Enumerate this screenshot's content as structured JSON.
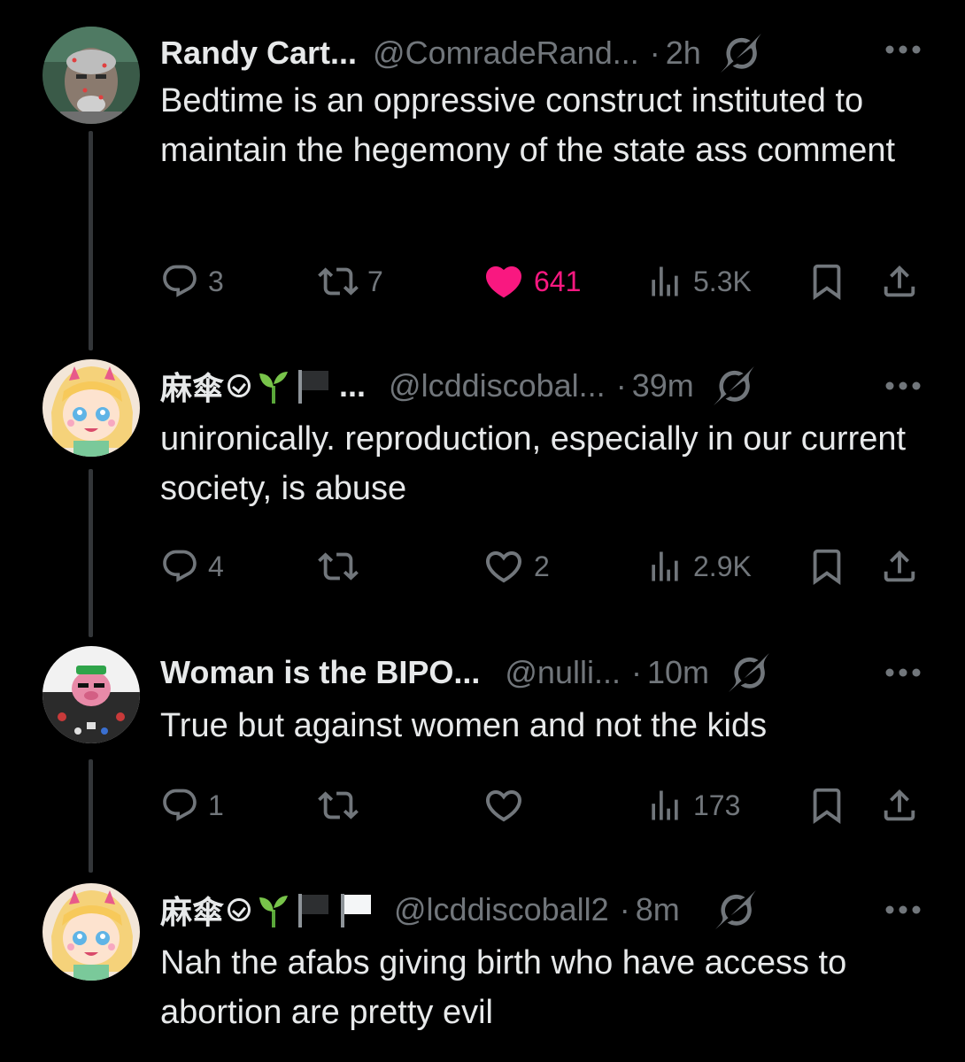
{
  "tweets": [
    {
      "name": "Randy Cart...",
      "handle": "@ComradeRand...",
      "dot": "·",
      "time": "2h",
      "text": "Bedtime is an oppressive construct instituted to maintain the hegemony of the state ass comment",
      "replies": "3",
      "reposts": "7",
      "likes": "641",
      "views": "5.3K",
      "liked": true
    },
    {
      "name": "麻傘",
      "name_suffix": "...",
      "handle": "@lcddiscobal...",
      "dot": "·",
      "time": "39m",
      "text": "unironically. reproduction, especially in our current society, is abuse",
      "replies": "4",
      "reposts": "",
      "likes": "2",
      "views": "2.9K",
      "liked": false
    },
    {
      "name": "Woman is the BIPO...",
      "handle": "@nulli...",
      "dot": "·",
      "time": "10m",
      "text": "True but against women and not the kids",
      "replies": "1",
      "reposts": "",
      "likes": "",
      "views": "173",
      "liked": false
    },
    {
      "name": "麻傘",
      "handle": "@lcddiscoball2",
      "dot": "·",
      "time": "8m",
      "text": "Nah the afabs giving birth who have access to abortion are pretty evil"
    }
  ],
  "colors": {
    "background": "#000000",
    "text": "#e7e9ea",
    "muted": "#71767b",
    "like": "#f91880",
    "thread_line": "#333639"
  },
  "icons": [
    "grok-icon",
    "more-icon",
    "reply-icon",
    "repost-icon",
    "like-icon",
    "views-icon",
    "bookmark-icon",
    "share-icon",
    "seedling-icon",
    "black-flag-icon",
    "white-flag-icon",
    "verified-badge-icon"
  ]
}
